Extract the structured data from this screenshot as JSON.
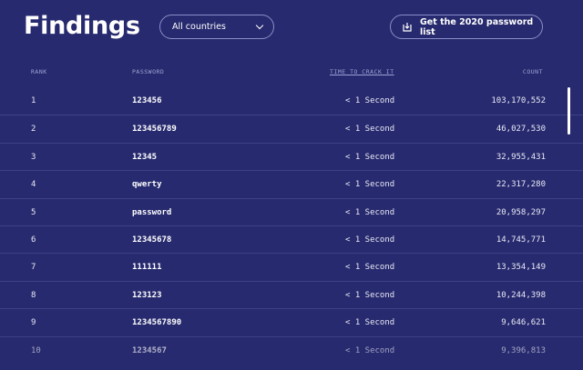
{
  "header": {
    "title": "Findings",
    "country_select": {
      "value": "All countries"
    },
    "download_button": {
      "label": "Get the 2020 password list"
    }
  },
  "table": {
    "columns": {
      "rank": "RANK",
      "password": "PASSWORD",
      "time": "TIME TO CRACK IT",
      "count": "COUNT"
    },
    "rows": [
      {
        "rank": "1",
        "password": "123456",
        "time": "< 1 Second",
        "count": "103,170,552"
      },
      {
        "rank": "2",
        "password": "123456789",
        "time": "< 1 Second",
        "count": "46,027,530"
      },
      {
        "rank": "3",
        "password": "12345",
        "time": "< 1 Second",
        "count": "32,955,431"
      },
      {
        "rank": "4",
        "password": "qwerty",
        "time": "< 1 Second",
        "count": "22,317,280"
      },
      {
        "rank": "5",
        "password": "password",
        "time": "< 1 Second",
        "count": "20,958,297"
      },
      {
        "rank": "6",
        "password": "12345678",
        "time": "< 1 Second",
        "count": "14,745,771"
      },
      {
        "rank": "7",
        "password": "111111",
        "time": "< 1 Second",
        "count": "13,354,149"
      },
      {
        "rank": "8",
        "password": "123123",
        "time": "< 1 Second",
        "count": "10,244,398"
      },
      {
        "rank": "9",
        "password": "1234567890",
        "time": "< 1 Second",
        "count": "9,646,621"
      },
      {
        "rank": "10",
        "password": "1234567",
        "time": "< 1 Second",
        "count": "9,396,813"
      }
    ]
  },
  "icons": {
    "country_select": "chevron-down-icon",
    "download_button": "download-icon"
  },
  "colors": {
    "background": "#272a6e",
    "row_divider": "#3d4185",
    "header_text": "#9ea2d4",
    "button_border": "#8a8fc9"
  }
}
